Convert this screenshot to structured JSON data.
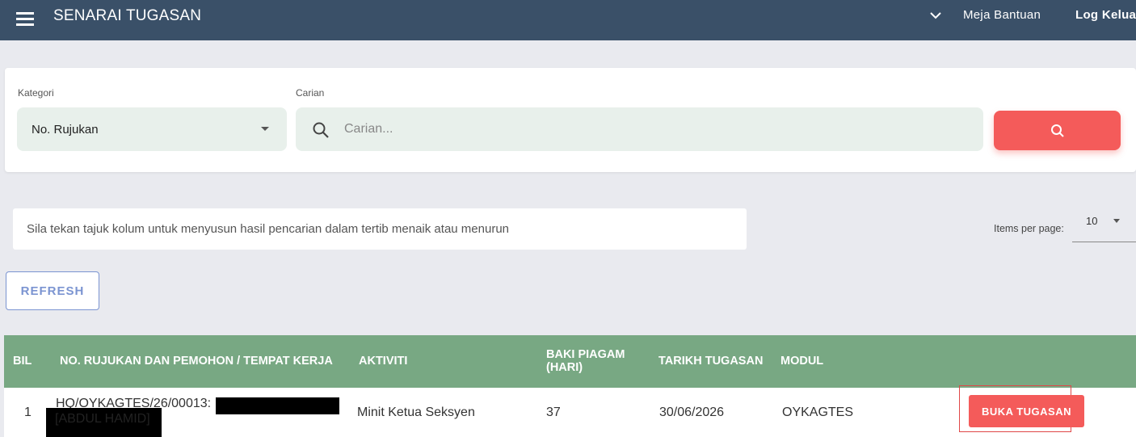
{
  "header": {
    "title": "SENARAI TUGASAN",
    "helpdesk_label": "Meja Bantuan",
    "logout_label": "Log Keluar"
  },
  "search": {
    "category_label": "Kategori",
    "category_value": "No. Rujukan",
    "search_label": "Carian",
    "search_placeholder": "Carian...",
    "search_value": ""
  },
  "info_text": "Sila tekan tajuk kolum untuk menyusun hasil pencarian dalam tertib menaik atau menurun",
  "pagination": {
    "items_per_page_label": "Items per page:",
    "items_per_page_value": "10"
  },
  "refresh_label": "REFRESH",
  "table": {
    "columns": {
      "bil": "BIL",
      "ref": "NO. RUJUKAN DAN PEMOHON / TEMPAT KERJA",
      "activity": "AKTIVITI",
      "baki_line1": "BAKI PIAGAM",
      "baki_line2": "(HARI)",
      "date": "TARIKH TUGASAN",
      "module": "MODUL"
    },
    "rows": [
      {
        "bil": "1",
        "ref": "HQ/OYKAGTES/26/00013:",
        "applicant": "[ABDUL HAMID]",
        "activity": "Minit Ketua Seksyen",
        "baki": "37",
        "date": "30/06/2026",
        "module": "OYKAGTES",
        "action_label": "BUKA TUGASAN"
      }
    ]
  },
  "colors": {
    "topbar": "#3a5068",
    "accent_red": "#f45b5a",
    "table_header": "#78a883",
    "refresh_border": "#7b94d1"
  }
}
